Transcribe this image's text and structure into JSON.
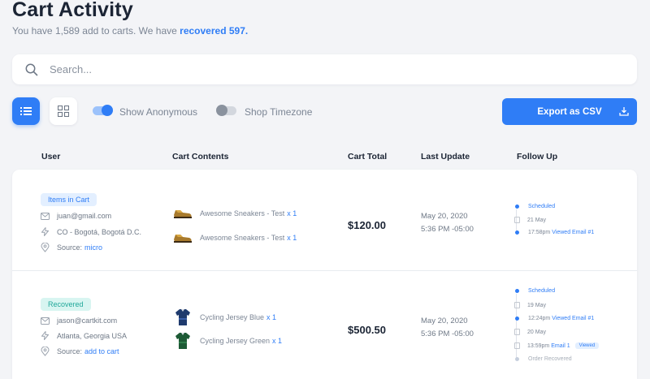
{
  "header": {
    "title": "Cart Activity",
    "subtitle_prefix": "You have 1,589 add to carts. We have",
    "subtitle_link": "recovered 597."
  },
  "search": {
    "placeholder": "Search...",
    "value": ""
  },
  "toolbar": {
    "show_anonymous_label": "Show Anonymous",
    "show_anonymous_on": true,
    "shop_timezone_label": "Shop Timezone",
    "shop_timezone_on": false,
    "export_label": "Export as CSV"
  },
  "columns": [
    "User",
    "Cart Contents",
    "Cart Total",
    "Last Update",
    "Follow Up"
  ],
  "rows": [
    {
      "status": "Items in Cart",
      "email": "juan@gmail.com",
      "location": "CO - Bogotá, Bogotá D.C.",
      "source_label": "Source:",
      "source": "micro",
      "products": [
        {
          "name": "Awesome Sneakers - Test",
          "qty": "x 1",
          "icon": "sneaker-icon"
        },
        {
          "name": "Awesome Sneakers - Test",
          "qty": "x 1",
          "icon": "sneaker-icon"
        }
      ],
      "total": "$120.00",
      "updated_date": "May 20, 2020",
      "updated_time": "5:36 PM -05:00",
      "followup": {
        "scheduled": "Scheduled",
        "date1": "21 May",
        "time1": "17:58pm",
        "action1": "Viewed Email #1"
      }
    },
    {
      "status": "Recovered",
      "email": "jason@cartkit.com",
      "location": "Atlanta, Georgia USA",
      "source_label": "Source:",
      "source": "add to cart",
      "products": [
        {
          "name": "Cycling Jersey Blue",
          "qty": "x 1",
          "icon": "jersey-blue-icon"
        },
        {
          "name": "Cycling Jersey Green",
          "qty": "x 1",
          "icon": "jersey-green-icon"
        }
      ],
      "total": "$500.50",
      "updated_date": "May 20, 2020",
      "updated_time": "5:36 PM -05:00",
      "followup": {
        "scheduled": "Scheduled",
        "date1": "19 May",
        "time1": "12:24pm",
        "action1": "Viewed Email #1",
        "date2": "20 May",
        "time2": "13:59pm",
        "action2": "Email 1",
        "chip": "Viewed",
        "final": "Order Recovered"
      }
    }
  ],
  "colors": {
    "accent": "#2f7df6",
    "recovered": "#21a89a",
    "background": "#f3f4f7"
  }
}
